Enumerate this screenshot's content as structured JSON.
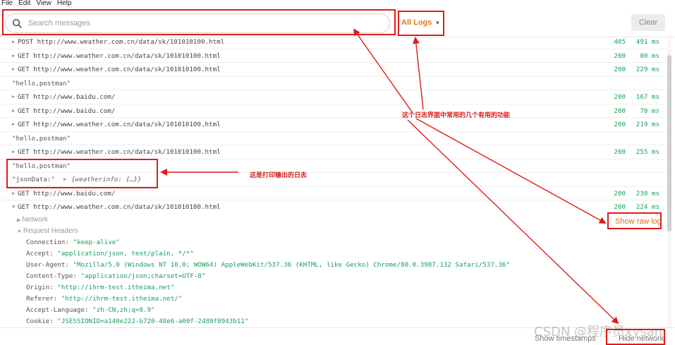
{
  "menubar": {
    "items": [
      "File",
      "Edit",
      "View",
      "Help"
    ]
  },
  "toolbar": {
    "search_placeholder": "Search messages",
    "filter_label": "All Logs",
    "clear_label": "Clear"
  },
  "logs": [
    {
      "kind": "request",
      "text": "POST http://www.weather.com.cn/data/sk/101010100.html",
      "status": "405",
      "time": "491 ms"
    },
    {
      "kind": "request",
      "text": "GET http://www.weather.com.cn/data/sk/101010100.html",
      "status": "200",
      "time": "80 ms"
    },
    {
      "kind": "request",
      "text": "GET http://www.weather.com.cn/data/sk/101010100.html",
      "status": "200",
      "time": "229 ms"
    },
    {
      "kind": "string",
      "text": "\"hello,postman\""
    },
    {
      "kind": "request",
      "text": "GET http://www.baidu.com/",
      "status": "200",
      "time": "167 ms"
    },
    {
      "kind": "request",
      "text": "GET http://www.baidu.com/",
      "status": "200",
      "time": "70 ms"
    },
    {
      "kind": "request",
      "text": "GET http://www.weather.com.cn/data/sk/101010100.html",
      "status": "200",
      "time": "219 ms"
    },
    {
      "kind": "string",
      "text": "\"hello,postman\""
    },
    {
      "kind": "request",
      "text": "GET http://www.weather.com.cn/data/sk/101010100.html",
      "status": "200",
      "time": "255 ms"
    },
    {
      "kind": "string",
      "text": "\"hello,postman\""
    },
    {
      "kind": "object",
      "text": "\"jsonData:\"",
      "obj": "{weatherinfo: {…}}"
    },
    {
      "kind": "request",
      "text": "GET http://www.baidu.com/",
      "status": "200",
      "time": "230 ms"
    },
    {
      "kind": "request",
      "text": "GET http://www.weather.com.cn/data/sk/101010100.html",
      "status": "200",
      "time": "224 ms",
      "expanded": true
    }
  ],
  "expanded_sections": {
    "network_label": "Network",
    "request_headers_label": "Request Headers"
  },
  "headers": [
    {
      "name": "Connection:",
      "value": "\"keep-alive\""
    },
    {
      "name": "Accept:",
      "value": "\"application/json, text/plain, */*\""
    },
    {
      "name": "User-Agent:",
      "value": "\"Mozilla/5.0 (Windows NT 10.0; WOW64) AppleWebKit/537.36 (KHTML, like Gecko) Chrome/80.0.3987.132 Safari/537.36\""
    },
    {
      "name": "Content-Type:",
      "value": "\"application/json;charset=UTF-8\""
    },
    {
      "name": "Origin:",
      "value": "\"http://ihrm-test.itheima.net\""
    },
    {
      "name": "Referer:",
      "value": "\"http://ihrm-test.itheima.net/\""
    },
    {
      "name": "Accept-Language:",
      "value": "\"zh-CN,zh;q=0.9\""
    },
    {
      "name": "Cookie:",
      "value": "\"JSESSIONID=a140e222-b720-48e6-a00f-2480f8943b11\""
    }
  ],
  "raw_log_label": "Show raw log",
  "footer": {
    "timestamps_label": "Show timestamps",
    "hide_network_label": "Hide network"
  },
  "watermark": "CSDN @程序员xysam",
  "annotations": {
    "features_note": "这个日志界面中常用的几个有用的功能",
    "printed_log_note": "这是打印输出的日志"
  },
  "colors": {
    "accent_orange": "#e07a1e",
    "status_green": "#18a058",
    "annotation_red": "#e01b1b"
  }
}
